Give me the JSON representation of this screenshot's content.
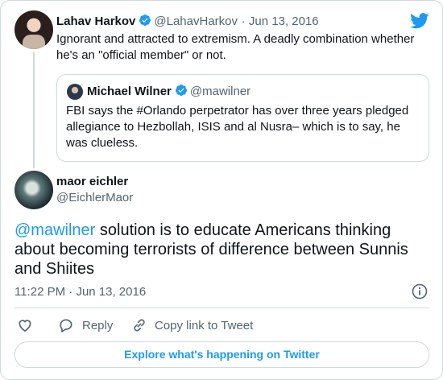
{
  "parent_tweet": {
    "name": "Lahav Harkov",
    "handle": "@LahavHarkov",
    "date": "Jun 13, 2016",
    "separator": "·",
    "text_line1": "Ignorant and attracted to extremism. A deadly combination whether",
    "text_line2": "he's an \"official member\" or not."
  },
  "quoted_tweet": {
    "name": "Michael Wilner",
    "handle": "@mawilner",
    "text_line1": "FBI says the #Orlando perpetrator has over three years pledged",
    "text_line2": "allegiance to Hezbollah, ISIS and al Nusra– which is to say, he",
    "text_line3": "was clueless."
  },
  "main_tweet": {
    "name": "maor eichler",
    "handle": "@EichlerMaor",
    "mention": "@mawilner",
    "text_rest": " solution is to educate Americans thinking about becoming terrorists of difference between Sunnis and Shiites",
    "time": "11:22 PM",
    "separator": "·",
    "date": "Jun 13, 2016"
  },
  "actions": {
    "reply_label": "Reply",
    "copy_link_label": "Copy link to Tweet"
  },
  "explore_label": "Explore what's happening on Twitter",
  "colors": {
    "accent": "#1d9bf0",
    "text": "#0f1419",
    "secondary": "#536471",
    "border": "#cfd9de"
  },
  "icons": [
    "twitter-bird-icon",
    "verified-badge-icon",
    "info-icon",
    "heart-icon",
    "reply-icon",
    "link-icon"
  ]
}
